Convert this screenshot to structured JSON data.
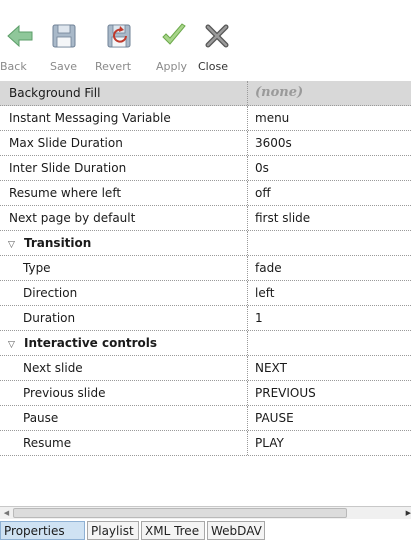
{
  "toolbar": {
    "back": {
      "label": "Back",
      "icon": "arrow-left-icon",
      "color": "#6aa84f"
    },
    "save": {
      "label": "Save",
      "icon": "floppy-disk-icon"
    },
    "revert": {
      "label": "Revert",
      "icon": "revert-icon"
    },
    "apply": {
      "label": "Apply",
      "icon": "checkmark-icon",
      "color": "#8bc34a"
    },
    "close": {
      "label": "Close",
      "icon": "close-x-icon"
    }
  },
  "properties": {
    "background_fill": {
      "name": "Background Fill",
      "value": "(none)"
    },
    "im_variable": {
      "name": "Instant Messaging Variable",
      "value": "menu"
    },
    "max_slide": {
      "name": "Max Slide Duration",
      "value": "3600s"
    },
    "inter_slide": {
      "name": "Inter Slide Duration",
      "value": "0s"
    },
    "resume_left": {
      "name": "Resume where left",
      "value": "off"
    },
    "next_page": {
      "name": "Next page by default",
      "value": "first slide"
    },
    "transition": {
      "label": "Transition",
      "type": {
        "name": "Type",
        "value": "fade"
      },
      "direction": {
        "name": "Direction",
        "value": "left"
      },
      "duration": {
        "name": "Duration",
        "value": "1"
      }
    },
    "interactive": {
      "label": "Interactive controls",
      "next": {
        "name": "Next slide",
        "value": "NEXT"
      },
      "previous": {
        "name": "Previous slide",
        "value": "PREVIOUS"
      },
      "pause": {
        "name": "Pause",
        "value": "PAUSE"
      },
      "resume": {
        "name": "Resume",
        "value": "PLAY"
      }
    }
  },
  "tabs": {
    "properties": "Properties",
    "playlist": "Playlist",
    "xml_tree": "XML Tree",
    "webdav": "WebDAV"
  },
  "colors": {
    "selected_row": "#d8d8d8",
    "active_tab": "#cfe2f3"
  }
}
